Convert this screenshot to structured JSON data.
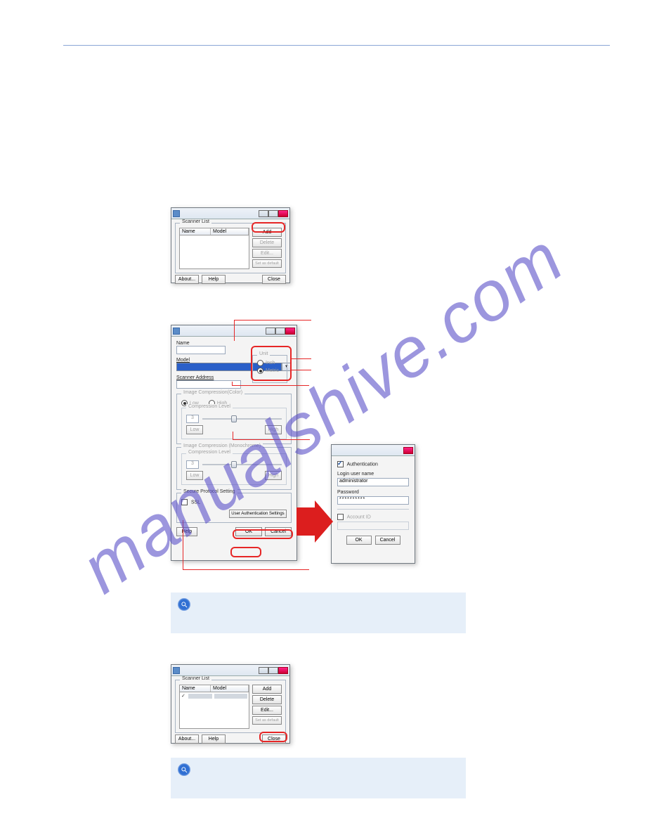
{
  "watermark": "manualshive.com",
  "dialog1": {
    "group_title": "Scanner List",
    "col_name": "Name",
    "col_model": "Model",
    "btn_add": "Add",
    "btn_delete": "Delete",
    "btn_edit": "Edit...",
    "btn_setdefault": "Set as default",
    "btn_about": "About...",
    "btn_help": "Help",
    "btn_close": "Close"
  },
  "dialog2": {
    "lbl_name": "Name",
    "lbl_model": "Model",
    "lbl_scanner_address": "Scanner Address",
    "group_unit": "Unit",
    "radio_inch": "Inch",
    "radio_metric": "Metric",
    "group_img_comp_color": "Image Compression(Color)",
    "radio_low": "Low",
    "radio_high": "High",
    "lbl_comp_level": "Compression Level",
    "level_num": "3",
    "lbl_low": "Low",
    "lbl_high": "High",
    "group_img_comp_mono": "Image Compression (Monochrome)",
    "lbl_comp_level2": "Compression Level",
    "level_num2": "3",
    "lbl_low2": "Low",
    "lbl_high2": "High",
    "group_secure": "Secure Protocol Setting",
    "chk_ssl": "SSL",
    "btn_user_auth": "User Authentication Settings",
    "btn_help": "Help",
    "btn_ok": "OK",
    "btn_cancel": "Cancel"
  },
  "dialog3": {
    "chk_auth": "Authentication",
    "lbl_login": "Login user name",
    "val_login": "administrator",
    "lbl_password": "Password",
    "val_password": "**********",
    "chk_account": "Account ID",
    "btn_ok": "OK",
    "btn_cancel": "Cancel"
  },
  "dialog4": {
    "group_title": "Scanner List",
    "col_name": "Name",
    "col_model": "Model",
    "btn_add": "Add",
    "btn_delete": "Delete",
    "btn_edit": "Edit...",
    "btn_setdefault": "Set as default",
    "btn_about": "About...",
    "btn_help": "Help",
    "btn_close": "Close",
    "check": "✓"
  }
}
